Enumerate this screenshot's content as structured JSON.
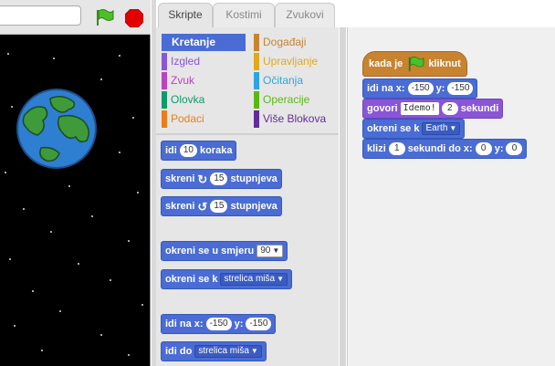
{
  "project": {
    "title": ""
  },
  "tabs": [
    "Skripte",
    "Kostimi",
    "Zvukovi"
  ],
  "categories": [
    {
      "label": "Kretanje",
      "color": "#4a6cd4"
    },
    {
      "label": "Izgled",
      "color": "#8a55d7"
    },
    {
      "label": "Zvuk",
      "color": "#bb42c3"
    },
    {
      "label": "Olovka",
      "color": "#0e9a6c"
    },
    {
      "label": "Podaci",
      "color": "#ee7d16"
    },
    {
      "label": "Događaji",
      "color": "#c88330"
    },
    {
      "label": "Upravljanje",
      "color": "#e1a91a"
    },
    {
      "label": "Očitanja",
      "color": "#2ca5e2"
    },
    {
      "label": "Operacije",
      "color": "#5cb712"
    },
    {
      "label": "Više Blokova",
      "color": "#632d99"
    }
  ],
  "palette": {
    "move": {
      "a": "idi",
      "n": "10",
      "b": "koraka"
    },
    "turn_right": {
      "a": "skreni",
      "n": "15",
      "b": "stupnjeva"
    },
    "turn_left": {
      "a": "skreni",
      "n": "15",
      "b": "stupnjeva"
    },
    "point_dir": {
      "a": "okreni se u smjeru",
      "v": "90"
    },
    "point_to": {
      "a": "okreni se k",
      "v": "strelica miša"
    },
    "goto_xy": {
      "a": "idi na x:",
      "x": "-150",
      "b": "y:",
      "y": "-150"
    },
    "goto": {
      "a": "idi do",
      "v": "strelica miša"
    }
  },
  "script": {
    "hat": {
      "a": "kada je",
      "b": "kliknut"
    },
    "goto_xy": {
      "a": "idi na x:",
      "x": "-150",
      "b": "y:",
      "y": "-150"
    },
    "say": {
      "a": "govori",
      "t": "Idemo!",
      "n": "2",
      "b": "sekundi"
    },
    "point_to": {
      "a": "okreni se k",
      "v": "Earth"
    },
    "glide": {
      "a": "klizi",
      "n": "1",
      "b": "sekundi do x:",
      "x": "0",
      "c": "y:",
      "y": "0"
    }
  }
}
